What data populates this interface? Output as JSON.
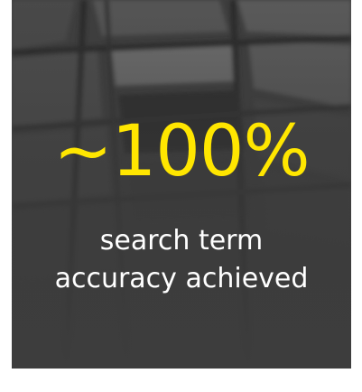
{
  "headline": {
    "value": "~100%",
    "color": "#ffe600"
  },
  "caption": {
    "line1": "search term",
    "line2": "accuracy achieved",
    "color": "#ffffff"
  },
  "background": {
    "base_color": "#3a3a3a"
  }
}
